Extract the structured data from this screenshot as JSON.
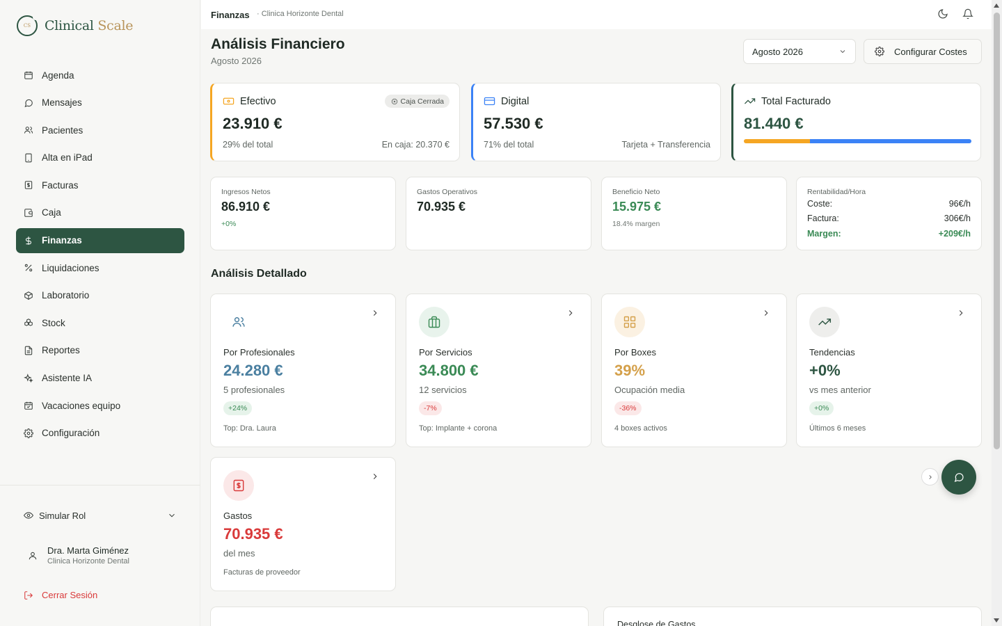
{
  "app": {
    "logo_mark": "CS",
    "name_primary": "Clinical",
    "name_accent": "Scale"
  },
  "sidebar": {
    "items": [
      {
        "label": "Agenda",
        "icon": "calendar-icon"
      },
      {
        "label": "Mensajes",
        "icon": "message-icon"
      },
      {
        "label": "Pacientes",
        "icon": "users-icon"
      },
      {
        "label": "Alta en iPad",
        "icon": "tablet-icon"
      },
      {
        "label": "Facturas",
        "icon": "invoice-icon"
      },
      {
        "label": "Caja",
        "icon": "wallet-icon"
      },
      {
        "label": "Finanzas",
        "icon": "dollar-icon",
        "active": true
      },
      {
        "label": "Liquidaciones",
        "icon": "percent-icon"
      },
      {
        "label": "Laboratorio",
        "icon": "box-icon"
      },
      {
        "label": "Stock",
        "icon": "boxes-icon"
      },
      {
        "label": "Reportes",
        "icon": "report-icon"
      },
      {
        "label": "Asistente IA",
        "icon": "sparkles-icon"
      },
      {
        "label": "Vacaciones equipo",
        "icon": "calendar-check-icon"
      },
      {
        "label": "Configuración",
        "icon": "gear-icon"
      }
    ],
    "simular_label": "Simular Rol",
    "user_name": "Dra. Marta Giménez",
    "user_org": "Clinica Horizonte Dental",
    "logout_label": "Cerrar Sesión"
  },
  "topbar": {
    "crumb_main": "Finanzas",
    "crumb_sub": "· Clinica Horizonte Dental"
  },
  "header": {
    "title": "Análisis Financiero",
    "subtitle": "Agosto 2026",
    "month_value": "Agosto 2026",
    "config_label": "Configurar Costes"
  },
  "summary": {
    "efectivo": {
      "label": "Efectivo",
      "badge": "Caja Cerrada",
      "value": "23.910 €",
      "pct": "29% del total",
      "caja": "En caja: 20.370 €"
    },
    "digital": {
      "label": "Digital",
      "value": "57.530 €",
      "pct": "71% del total",
      "detail": "Tarjeta + Transferencia"
    },
    "total": {
      "label": "Total Facturado",
      "value": "81.440 €",
      "cash_share": 0.29,
      "digital_share": 0.71
    }
  },
  "kpis": {
    "ingresos": {
      "label": "Ingresos Netos",
      "value": "86.910 €",
      "note": "+0%"
    },
    "gastos": {
      "label": "Gastos Operativos",
      "value": "70.935 €"
    },
    "beneficio": {
      "label": "Beneficio Neto",
      "value": "15.975 €",
      "note": "18.4% margen"
    },
    "rentabilidad": {
      "label": "Rentabilidad/Hora",
      "coste_label": "Coste:",
      "coste_value": "96€/h",
      "factura_label": "Factura:",
      "factura_value": "306€/h",
      "margen_label": "Margen:",
      "margen_value": "+209€/h"
    }
  },
  "analysis": {
    "title": "Análisis Detallado",
    "cards": [
      {
        "title": "Por Profesionales",
        "value": "24.280 €",
        "sub": "5 profesionales",
        "badge": "+24%",
        "foot": "Top: Dra. Laura"
      },
      {
        "title": "Por Servicios",
        "value": "34.800 €",
        "sub": "12 servicios",
        "badge": "-7%",
        "foot": "Top: Implante + corona"
      },
      {
        "title": "Por Boxes",
        "value": "39%",
        "sub": "Ocupación media",
        "badge": "-36%",
        "foot": "4 boxes activos"
      },
      {
        "title": "Tendencias",
        "value": "+0%",
        "sub": "vs mes anterior",
        "badge": "+0%",
        "foot": "Últimos 6 meses"
      },
      {
        "title": "Gastos",
        "value": "70.935 €",
        "sub": "del mes",
        "foot": "Facturas de proveedor"
      }
    ]
  },
  "bottom": {
    "right_title": "Desglose de Gastos"
  },
  "colors": {
    "brand": "#2d5542",
    "cash": "#f5a623",
    "digital": "#3b82f6",
    "positive": "#3a8a55",
    "negative": "#d93a3a"
  }
}
